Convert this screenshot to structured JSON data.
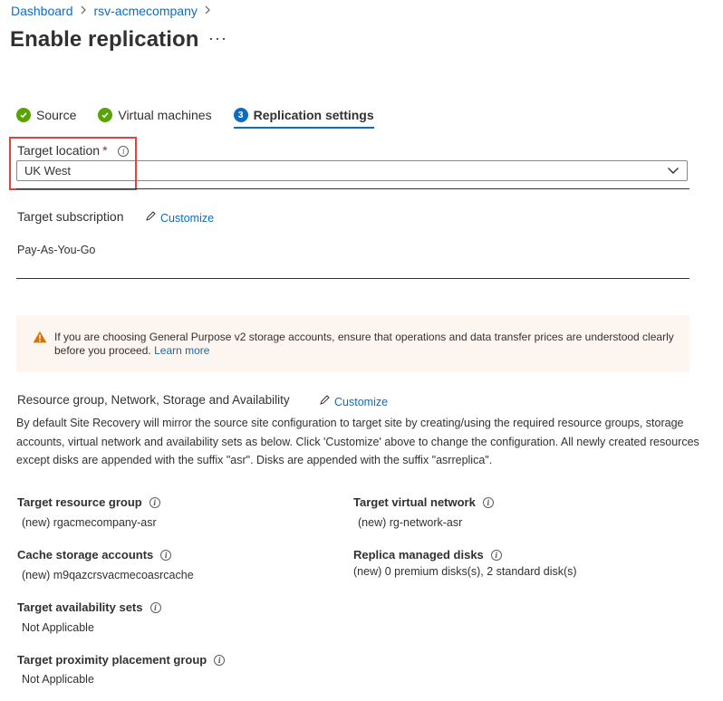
{
  "breadcrumb": {
    "items": [
      "Dashboard",
      "rsv-acmecompany"
    ]
  },
  "page": {
    "title": "Enable replication",
    "more_label": "···"
  },
  "tabs": [
    {
      "label": "Source",
      "state": "complete"
    },
    {
      "label": "Virtual machines",
      "state": "complete"
    },
    {
      "label": "Replication settings",
      "state": "active",
      "step": "3"
    }
  ],
  "target_location": {
    "label": "Target location",
    "required_marker": "*",
    "value": "UK West"
  },
  "target_subscription": {
    "label": "Target subscription",
    "customize_label": "Customize",
    "value": "Pay-As-You-Go"
  },
  "warning": {
    "text": "If you are choosing General Purpose v2 storage accounts, ensure that operations and data transfer prices are understood clearly before you proceed.",
    "link": "Learn more"
  },
  "resource_section": {
    "title": "Resource group, Network, Storage and Availability",
    "customize_label": "Customize",
    "description": "By default Site Recovery will mirror the source site configuration to target site by creating/using the required resource groups, storage accounts, virtual network and availability sets as below. Click 'Customize' above to change the configuration. All newly created resources except disks are appended with the suffix \"asr\". Disks are appended with the suffix \"asrreplica\"."
  },
  "properties": {
    "target_resource_group": {
      "title": "Target resource group",
      "value": "(new) rgacmecompany-asr"
    },
    "target_virtual_network": {
      "title": "Target virtual network",
      "value": "(new) rg-network-asr"
    },
    "cache_storage_accounts": {
      "title": "Cache storage accounts",
      "value": "(new) m9qazcrsvacmecoasrcache"
    },
    "replica_managed_disks": {
      "title": "Replica managed disks",
      "value": "(new) 0 premium disks(s), 2 standard disk(s)"
    },
    "target_availability_sets": {
      "title": "Target availability sets",
      "value": "Not Applicable"
    },
    "target_proximity_placement_group": {
      "title": "Target proximity placement group",
      "value": "Not Applicable"
    }
  },
  "colors": {
    "accent": "#0f6cbd",
    "success": "#57a300",
    "warning_bg": "#fdf6f0",
    "warning_icon": "#d47500",
    "highlight": "#e0423c"
  }
}
